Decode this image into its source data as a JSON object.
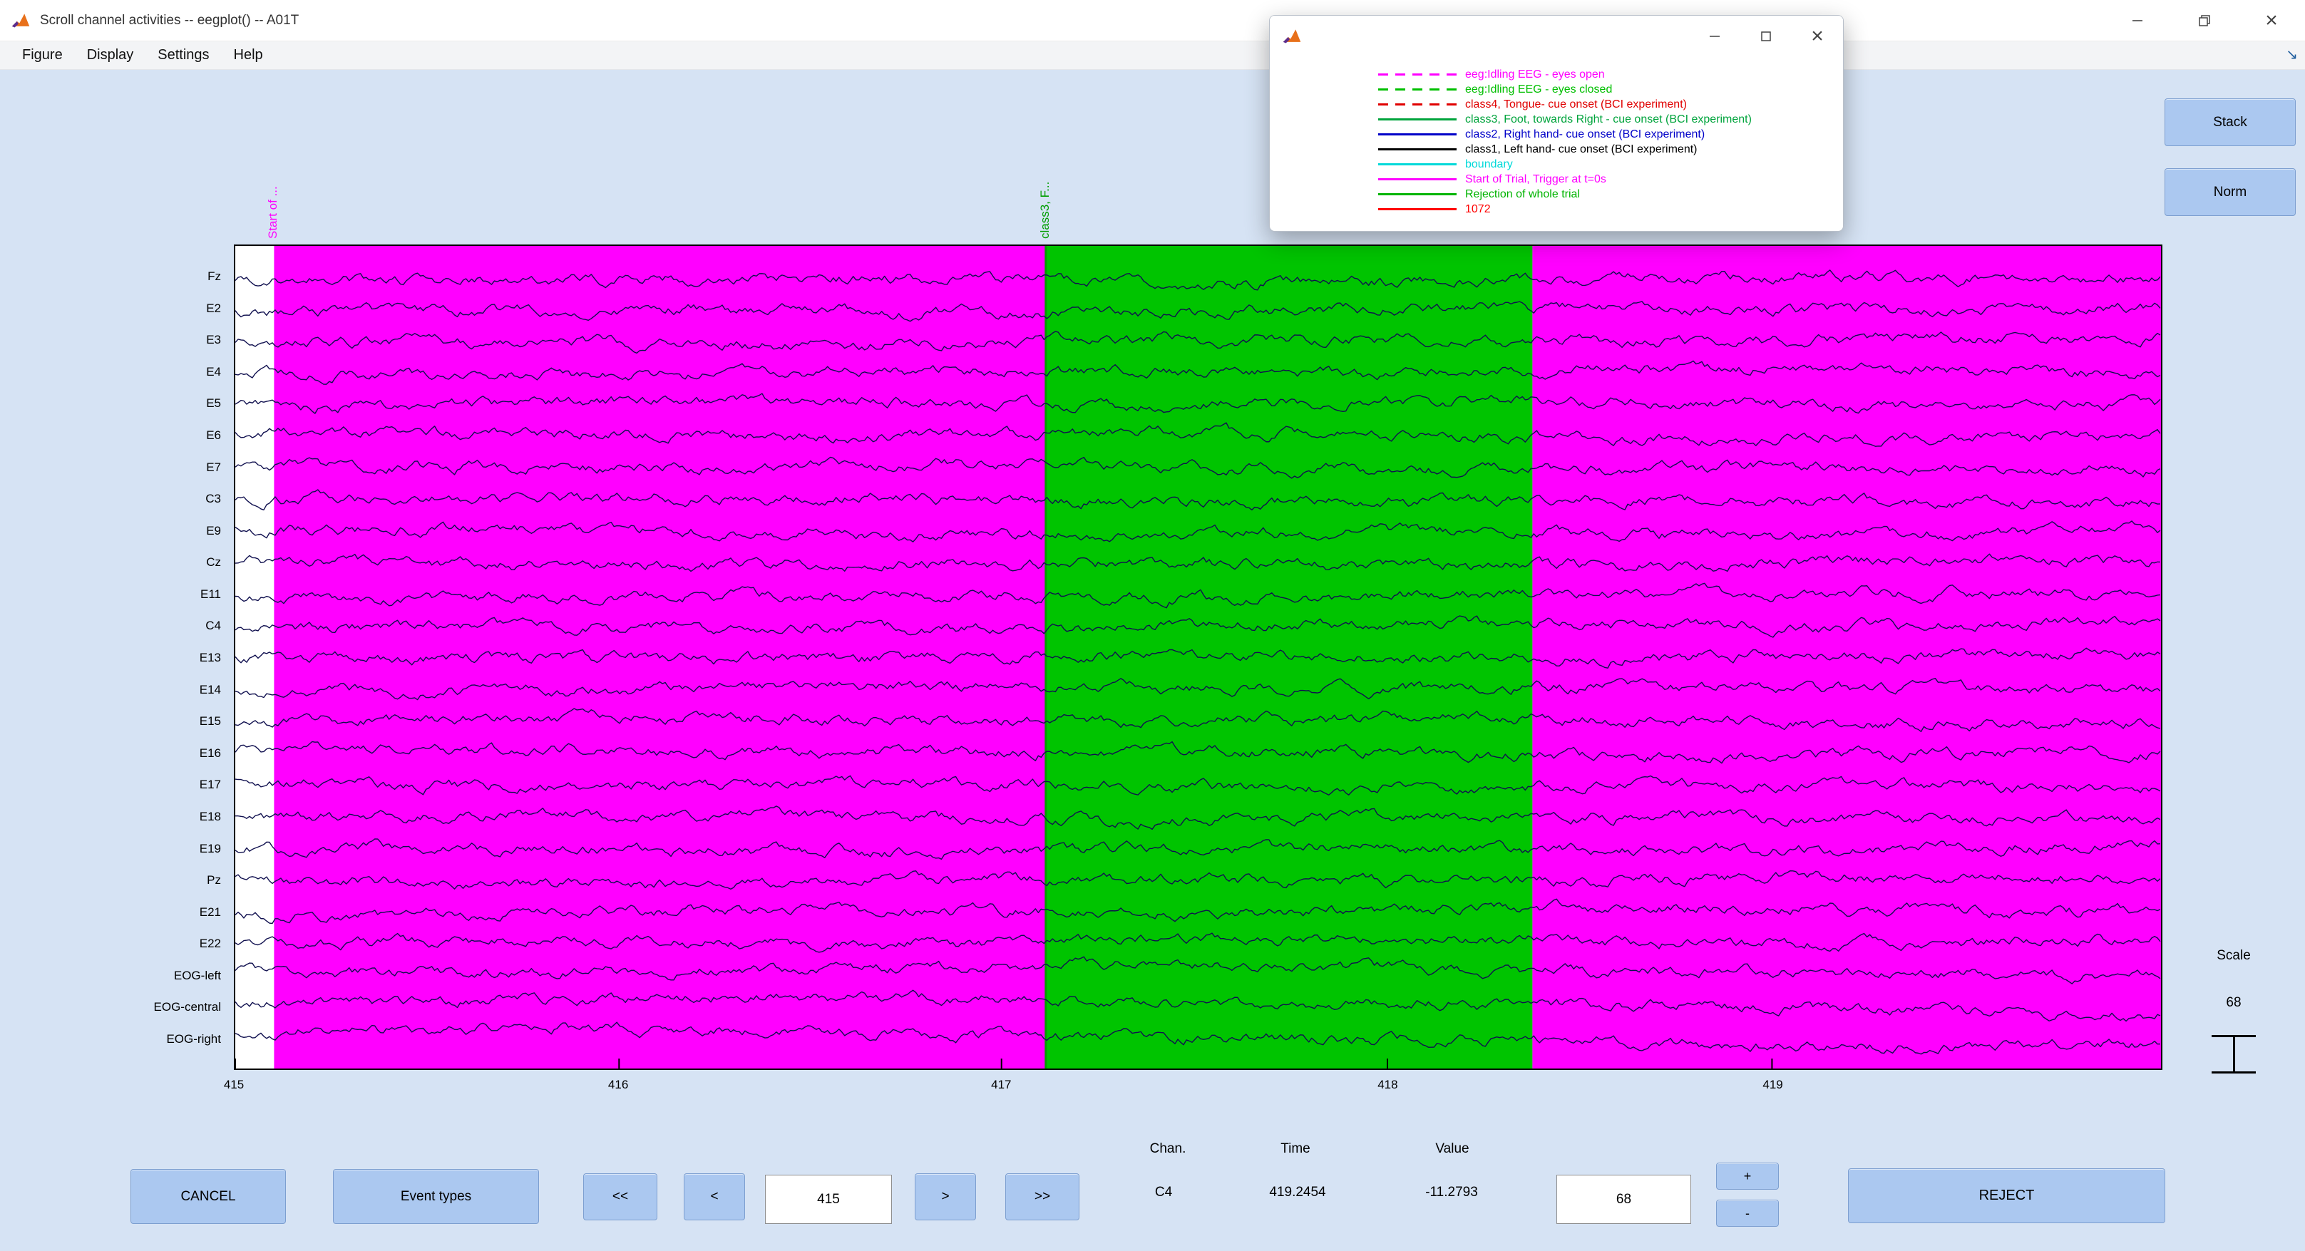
{
  "window": {
    "title": "Scroll channel activities -- eegplot() -- A01T",
    "menu_items": [
      "Figure",
      "Display",
      "Settings",
      "Help"
    ]
  },
  "legend_window": {
    "items": [
      {
        "label": "eeg:Idling EEG - eyes open",
        "color": "#ff00ff",
        "style": "dashed"
      },
      {
        "label": "eeg:Idling EEG - eyes closed",
        "color": "#00bf00",
        "style": "dashed"
      },
      {
        "label": "class4, Tongue- cue onset (BCI experiment)",
        "color": "#e00000",
        "style": "dashed"
      },
      {
        "label": "class3, Foot, towards Right - cue onset (BCI experiment)",
        "color": "#00a43c",
        "style": "solid"
      },
      {
        "label": "class2, Right hand- cue onset (BCI experiment)",
        "color": "#0000c8",
        "style": "solid"
      },
      {
        "label": "class1, Left hand- cue onset (BCI experiment)",
        "color": "#000000",
        "style": "solid"
      },
      {
        "label": "boundary",
        "color": "#00d9d9",
        "style": "solid"
      },
      {
        "label": "Start of Trial, Trigger at t=0s",
        "color": "#ff00ff",
        "style": "solid"
      },
      {
        "label": "Rejection of whole trial",
        "color": "#00b400",
        "style": "solid"
      },
      {
        "label": "1072",
        "color": "#ff0000",
        "style": "solid"
      }
    ]
  },
  "plot": {
    "channels": [
      "Fz",
      "E2",
      "E3",
      "E4",
      "E5",
      "E6",
      "E7",
      "C3",
      "E9",
      "Cz",
      "E11",
      "C4",
      "E13",
      "E14",
      "E15",
      "E16",
      "E17",
      "E18",
      "E19",
      "Pz",
      "E21",
      "E22",
      "EOG-left",
      "EOG-central",
      "EOG-right"
    ],
    "x_ticks": [
      {
        "label": "415",
        "frac": 0.0
      },
      {
        "label": "416",
        "frac": 0.1993
      },
      {
        "label": "417",
        "frac": 0.3979
      },
      {
        "label": "418",
        "frac": 0.5983
      },
      {
        "label": "419",
        "frac": 0.798
      }
    ],
    "regions": [
      {
        "start": 0.0,
        "end": 0.0207,
        "color": "#ffffff"
      },
      {
        "start": 0.0207,
        "end": 0.4209,
        "color": "#ff00ff"
      },
      {
        "start": 0.4209,
        "end": 0.6736,
        "color": "#00c400"
      },
      {
        "start": 0.6736,
        "end": 1.0,
        "color": "#ff00ff"
      }
    ],
    "events": [
      {
        "label": "Start of ...",
        "color": "#ff00ff",
        "frac": 0.0207
      },
      {
        "label": "class3, F...",
        "color": "#009e00",
        "frac": 0.4209
      }
    ],
    "trace_color": "#10104f"
  },
  "right_panel": {
    "stack_label": "Stack",
    "norm_label": "Norm",
    "scale_label": "Scale",
    "scale_value": "68"
  },
  "bottom_bar": {
    "cancel_label": "CANCEL",
    "event_types_label": "Event types",
    "fast_back_label": "<<",
    "back_label": "<",
    "time_field_value": "415",
    "forward_label": ">",
    "fast_forward_label": ">>",
    "chan_header": "Chan.",
    "time_header": "Time",
    "value_header": "Value",
    "chan_value": "C4",
    "time_value": "419.2454",
    "value_value": "-11.2793",
    "scale_field_value": "68",
    "plus_label": "+",
    "minus_label": "-",
    "reject_label": "REJECT"
  }
}
